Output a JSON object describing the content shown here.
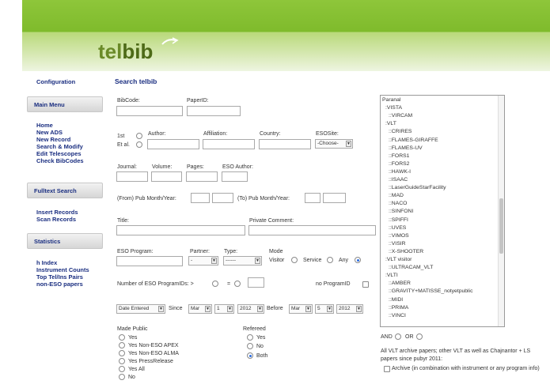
{
  "header": {
    "logo_tel": "tel",
    "logo_bib": "bib"
  },
  "sidebar": {
    "configuration": "Configuration",
    "main_menu": "Main Menu",
    "main_items": [
      "Home",
      "New ADS",
      "New Record",
      "Search & Modify",
      "Edit Telescopes",
      "Check BibCodes"
    ],
    "fulltext": "Fulltext Search",
    "fulltext_items": [
      "Insert Records",
      "Scan Records"
    ],
    "statistics": "Statistics",
    "stat_items": [
      "h Index",
      "Instrument Counts",
      "Top Tel/Ins Pairs",
      "non-ESO papers"
    ]
  },
  "search": {
    "title": "Search telbib",
    "bibcode": "BibCode:",
    "paperid": "PaperID:",
    "first": "1st",
    "etal": "Et al.",
    "author": "Author:",
    "affiliation": "Affiliation:",
    "country": "Country:",
    "esosite": "ESOSite:",
    "esosite_value": "-Choose-",
    "journal": "Journal:",
    "volume": "Volume:",
    "pages": "Pages:",
    "eso_author": "ESO Author:",
    "from_pub": "(From) Pub Month/Year:",
    "to_pub": "(To) Pub Month/Year:",
    "title_field": "Title:",
    "private_comment": "Private Comment:",
    "eso_program": "ESO Program:",
    "partner": "Partner:",
    "partner_value": "-",
    "type": "Type:",
    "type_value": "------",
    "mode": "Mode",
    "visitor": "Visitor",
    "service": "Service",
    "any": "Any",
    "num_programs": "Number of ESO ProgramIDs: >",
    "eq": "=",
    "no_program": "no ProgramID",
    "date_entered": "Date Entered",
    "since": "Since",
    "since_month": "Mar",
    "since_day": "1",
    "since_year": "2012",
    "before": "Before",
    "before_month": "Mar",
    "before_day": "5",
    "before_year": "2012",
    "made_public": "Made Public",
    "public_options": [
      "Yes",
      "Yes Non-ESO APEX",
      "Yes Non-ESO ALMA",
      "Yes PressRelease",
      "Yes All",
      "No"
    ],
    "refereed": "Refereed",
    "refereed_options": [
      "Yes",
      "No",
      "Both"
    ],
    "and": "AND",
    "or": "OR",
    "vlt_note": "All VLT archive papers; other VLT as well as Chajnantor + LS papers since pubyr 2011:",
    "archive": "Archive (in combination with instrument or any program info)"
  },
  "telescopes": [
    "Paranal",
    " :VISTA",
    "  ::VIRCAM",
    " :VLT",
    "  ::CRIRES",
    "  ::FLAMES-GIRAFFE",
    "  ::FLAMES-UV",
    "  ::FORS1",
    "  ::FORS2",
    "  ::HAWK-I",
    "  ::ISAAC",
    "  ::LaserGuideStarFacility",
    "  ::MAD",
    "  ::NACO",
    "  ::SINFONI",
    "  ::SPIFFI",
    "  ::UVES",
    "  ::VIMOS",
    "  ::VISIR",
    "  ::X-SHOOTER",
    " :VLT visitor",
    "  ::ULTRACAM_VLT",
    " :VLTI",
    "  ::AMBER",
    "  ::GRAVITY+MATISSE_notyetpublic",
    "  ::MIDI",
    "  ::PRIMA",
    "  ::VINCI"
  ]
}
